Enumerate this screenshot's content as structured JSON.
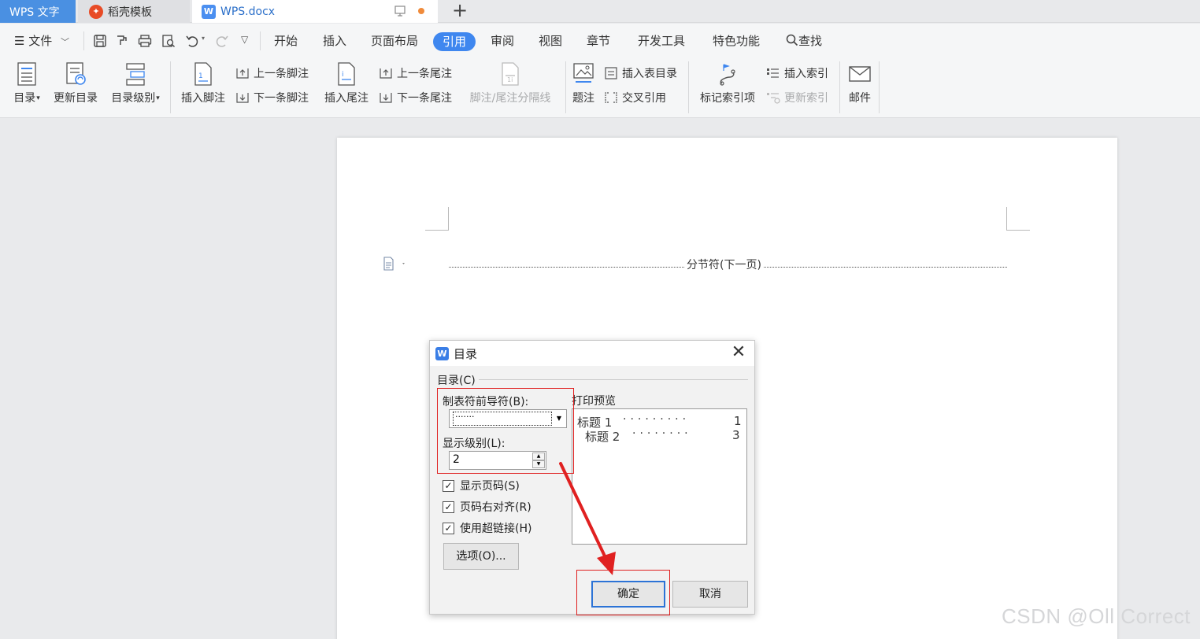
{
  "tabs": {
    "app": "WPS 文字",
    "docer": "稻壳模板",
    "doc": "WPS.docx",
    "docer_icon": "docer-flame-icon",
    "doc_icon": "wps-writer-icon"
  },
  "menu": {
    "file": "文件",
    "items": [
      "开始",
      "插入",
      "页面布局",
      "引用",
      "审阅",
      "视图",
      "章节",
      "开发工具",
      "特色功能",
      "查找"
    ],
    "active": "引用",
    "accent_color": "#3f87ef"
  },
  "ribbon": {
    "toc": "目录",
    "update_toc": "更新目录",
    "toc_level": "目录级别",
    "insert_footnote": "插入脚注",
    "prev_footnote": "上一条脚注",
    "next_footnote": "下一条脚注",
    "insert_endnote": "插入尾注",
    "prev_endnote": "上一条尾注",
    "next_endnote": "下一条尾注",
    "separator": "脚注/尾注分隔线",
    "caption": "题注",
    "insert_table_toc": "插入表目录",
    "cross_ref": "交叉引用",
    "mark_index": "标记索引项",
    "insert_index": "插入索引",
    "update_index": "更新索引",
    "mail": "邮件"
  },
  "document": {
    "section_break": "分节符(下一页)"
  },
  "dialog": {
    "title": "目录",
    "group": "目录(C)",
    "leader_label": "制表符前导符(B):",
    "leader_value": "·······",
    "level_label": "显示级别(L):",
    "level_value": "2",
    "show_page_numbers": "显示页码(S)",
    "right_align": "页码右对齐(R)",
    "use_hyperlinks": "使用超链接(H)",
    "options": "选项(O)...",
    "preview_label": "打印预览",
    "preview": [
      {
        "text": "标题 1",
        "dots": "·········",
        "page": "1"
      },
      {
        "text": "标题 2",
        "dots": "········",
        "page": "3"
      }
    ],
    "ok": "确定",
    "cancel": "取消",
    "checkmark": "✓"
  },
  "watermark": "CSDN @Oll Correct",
  "annotation_color": "#e02020"
}
